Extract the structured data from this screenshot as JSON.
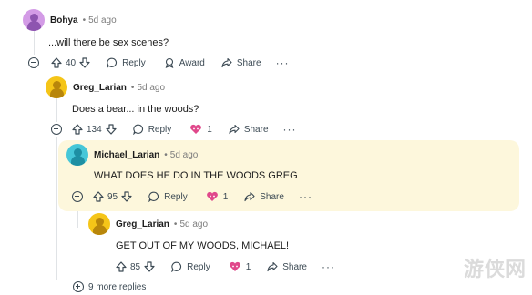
{
  "comments": [
    {
      "author": "Bohya",
      "time": "5d ago",
      "text": "...will there be sex scenes?",
      "votes": "40",
      "reply_label": "Reply",
      "award_label": "Award",
      "share_label": "Share",
      "more_label": "···",
      "avatar_color": "#d39be6"
    },
    {
      "author": "Greg_Larian",
      "time": "5d ago",
      "text": "Does a bear... in the woods?",
      "votes": "134",
      "reply_label": "Reply",
      "award_count": "1",
      "share_label": "Share",
      "more_label": "···",
      "avatar_color": "#f5c518"
    },
    {
      "author": "Michael_Larian",
      "time": "5d ago",
      "text": "WHAT DOES HE DO IN THE WOODS GREG",
      "votes": "95",
      "reply_label": "Reply",
      "award_count": "1",
      "share_label": "Share",
      "more_label": "···",
      "avatar_color": "#46c7d8"
    },
    {
      "author": "Greg_Larian",
      "time": "5d ago",
      "text": "GET OUT OF MY WOODS, MICHAEL!",
      "votes": "85",
      "reply_label": "Reply",
      "award_count": "1",
      "share_label": "Share",
      "more_label": "···",
      "avatar_color": "#f5c518"
    }
  ],
  "dot": "•",
  "more_replies": "9 more replies",
  "watermark": "游侠网",
  "colors": {
    "highlight": "#fdf7dc",
    "award": "#e0488b"
  }
}
